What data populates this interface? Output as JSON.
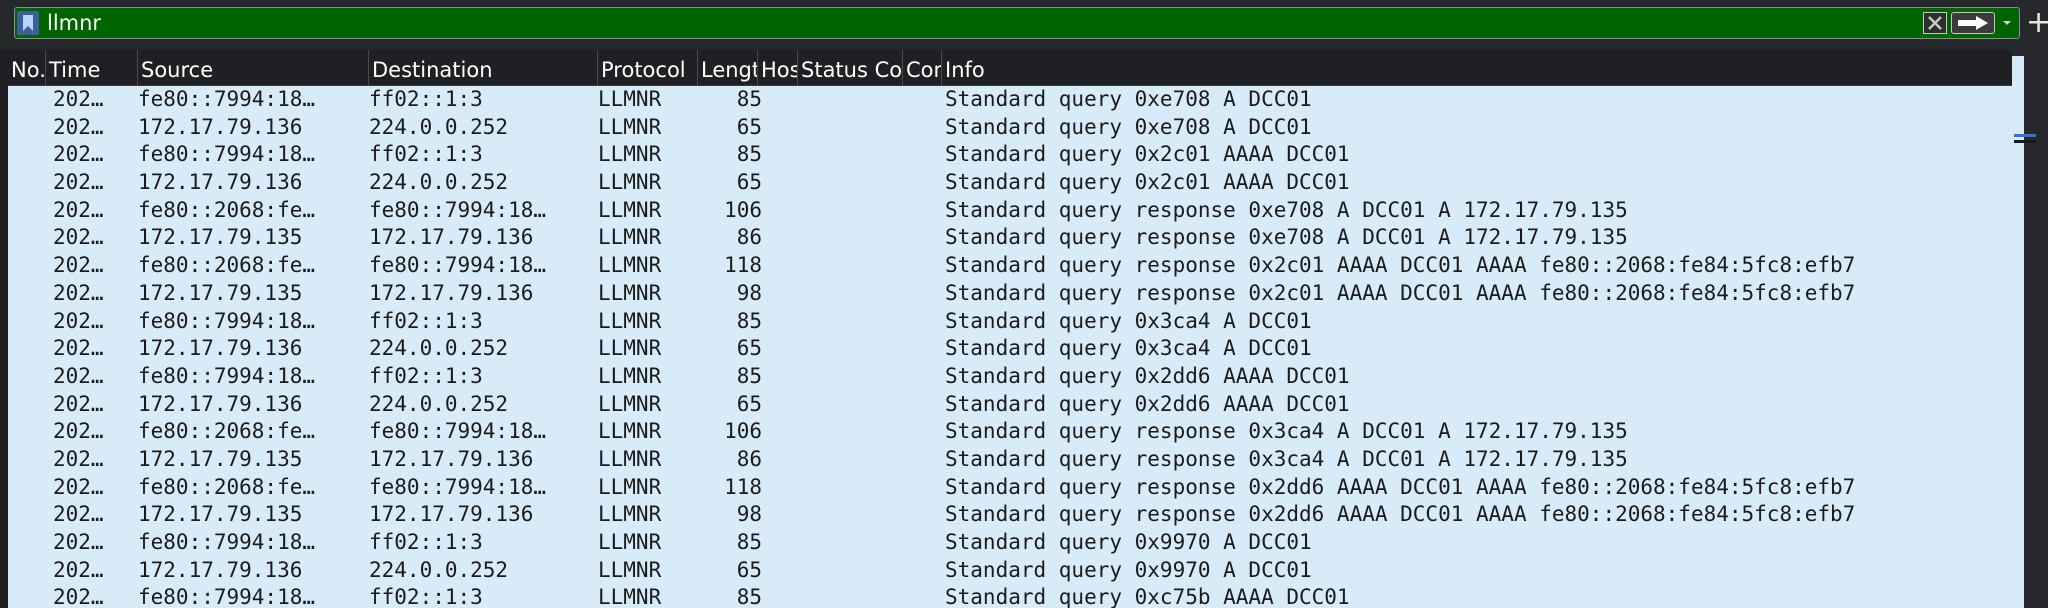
{
  "filter": {
    "value": "llmnr",
    "background": "#006400"
  },
  "icons": {
    "bookmark": "bookmark-icon",
    "clear": "clear-icon",
    "apply": "arrow-right-icon",
    "dropdown": "chevron-down-icon",
    "add": "plus-icon",
    "add_glyph": "+"
  },
  "columns": {
    "no": "No.",
    "time": "Time",
    "source": "Source",
    "destination": "Destination",
    "protocol": "Protocol",
    "length": "Length",
    "host": "Host",
    "status": "Status Code",
    "content": "Content",
    "info": "Info"
  },
  "packets": [
    {
      "time": "202…",
      "source": "fe80::7994:18…",
      "destination": "ff02::1:3",
      "protocol": "LLMNR",
      "length": "85",
      "info": "Standard query 0xe708 A DCC01"
    },
    {
      "time": "202…",
      "source": "172.17.79.136",
      "destination": "224.0.0.252",
      "protocol": "LLMNR",
      "length": "65",
      "info": "Standard query 0xe708 A DCC01"
    },
    {
      "time": "202…",
      "source": "fe80::7994:18…",
      "destination": "ff02::1:3",
      "protocol": "LLMNR",
      "length": "85",
      "info": "Standard query 0x2c01 AAAA DCC01"
    },
    {
      "time": "202…",
      "source": "172.17.79.136",
      "destination": "224.0.0.252",
      "protocol": "LLMNR",
      "length": "65",
      "info": "Standard query 0x2c01 AAAA DCC01"
    },
    {
      "time": "202…",
      "source": "fe80::2068:fe…",
      "destination": "fe80::7994:18…",
      "protocol": "LLMNR",
      "length": "106",
      "info": "Standard query response 0xe708 A DCC01 A 172.17.79.135"
    },
    {
      "time": "202…",
      "source": "172.17.79.135",
      "destination": "172.17.79.136",
      "protocol": "LLMNR",
      "length": "86",
      "info": "Standard query response 0xe708 A DCC01 A 172.17.79.135"
    },
    {
      "time": "202…",
      "source": "fe80::2068:fe…",
      "destination": "fe80::7994:18…",
      "protocol": "LLMNR",
      "length": "118",
      "info": "Standard query response 0x2c01 AAAA DCC01 AAAA fe80::2068:fe84:5fc8:efb7"
    },
    {
      "time": "202…",
      "source": "172.17.79.135",
      "destination": "172.17.79.136",
      "protocol": "LLMNR",
      "length": "98",
      "info": "Standard query response 0x2c01 AAAA DCC01 AAAA fe80::2068:fe84:5fc8:efb7"
    },
    {
      "time": "202…",
      "source": "fe80::7994:18…",
      "destination": "ff02::1:3",
      "protocol": "LLMNR",
      "length": "85",
      "info": "Standard query 0x3ca4 A DCC01"
    },
    {
      "time": "202…",
      "source": "172.17.79.136",
      "destination": "224.0.0.252",
      "protocol": "LLMNR",
      "length": "65",
      "info": "Standard query 0x3ca4 A DCC01"
    },
    {
      "time": "202…",
      "source": "fe80::7994:18…",
      "destination": "ff02::1:3",
      "protocol": "LLMNR",
      "length": "85",
      "info": "Standard query 0x2dd6 AAAA DCC01"
    },
    {
      "time": "202…",
      "source": "172.17.79.136",
      "destination": "224.0.0.252",
      "protocol": "LLMNR",
      "length": "65",
      "info": "Standard query 0x2dd6 AAAA DCC01"
    },
    {
      "time": "202…",
      "source": "fe80::2068:fe…",
      "destination": "fe80::7994:18…",
      "protocol": "LLMNR",
      "length": "106",
      "info": "Standard query response 0x3ca4 A DCC01 A 172.17.79.135"
    },
    {
      "time": "202…",
      "source": "172.17.79.135",
      "destination": "172.17.79.136",
      "protocol": "LLMNR",
      "length": "86",
      "info": "Standard query response 0x3ca4 A DCC01 A 172.17.79.135"
    },
    {
      "time": "202…",
      "source": "fe80::2068:fe…",
      "destination": "fe80::7994:18…",
      "protocol": "LLMNR",
      "length": "118",
      "info": "Standard query response 0x2dd6 AAAA DCC01 AAAA fe80::2068:fe84:5fc8:efb7"
    },
    {
      "time": "202…",
      "source": "172.17.79.135",
      "destination": "172.17.79.136",
      "protocol": "LLMNR",
      "length": "98",
      "info": "Standard query response 0x2dd6 AAAA DCC01 AAAA fe80::2068:fe84:5fc8:efb7"
    },
    {
      "time": "202…",
      "source": "fe80::7994:18…",
      "destination": "ff02::1:3",
      "protocol": "LLMNR",
      "length": "85",
      "info": "Standard query 0x9970 A DCC01"
    },
    {
      "time": "202…",
      "source": "172.17.79.136",
      "destination": "224.0.0.252",
      "protocol": "LLMNR",
      "length": "65",
      "info": "Standard query 0x9970 A DCC01"
    },
    {
      "time": "202…",
      "source": "fe80::7994:18…",
      "destination": "ff02::1:3",
      "protocol": "LLMNR",
      "length": "85",
      "info": "Standard query 0xc75b AAAA DCC01"
    }
  ],
  "colors": {
    "row_background": "#d8ebf9",
    "header_background": "#1f2023",
    "accent": "#3a6fd8"
  }
}
